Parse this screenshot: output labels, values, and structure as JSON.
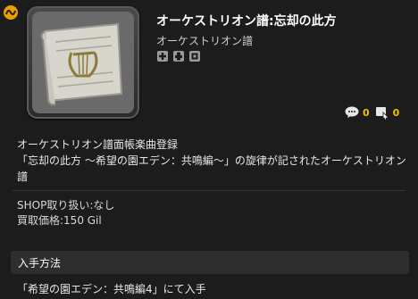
{
  "item": {
    "name": "オーケストリオン譜:忘却の此方",
    "category": "オーケストリオン譜",
    "job_icons": [
      "tank-role-icon",
      "healer-role-icon",
      "dps-role-icon"
    ],
    "icon": "orchestrion-scroll-lyre-icon"
  },
  "stats": {
    "comments_icon": "speech-bubble-icon",
    "comments": "0",
    "bookmarks_icon": "bookmark-cursor-icon",
    "bookmarks": "0"
  },
  "description": {
    "line1": "オーケストリオン譜面帳楽曲登録",
    "line2": "「忘却の此方 ～希望の園エデン：共鳴編～」の旋律が記されたオーケストリオン譜"
  },
  "shop": {
    "handling": "SHOP取り扱い:なし",
    "price": "買取価格:150 Gil"
  },
  "acquisition": {
    "header": "入手方法",
    "method": "「希望の園エデン：共鳴編4」にて入手"
  },
  "colors": {
    "background": "#1c1c1c",
    "accent": "#f0c000",
    "header_bg": "#2e2e2e"
  }
}
